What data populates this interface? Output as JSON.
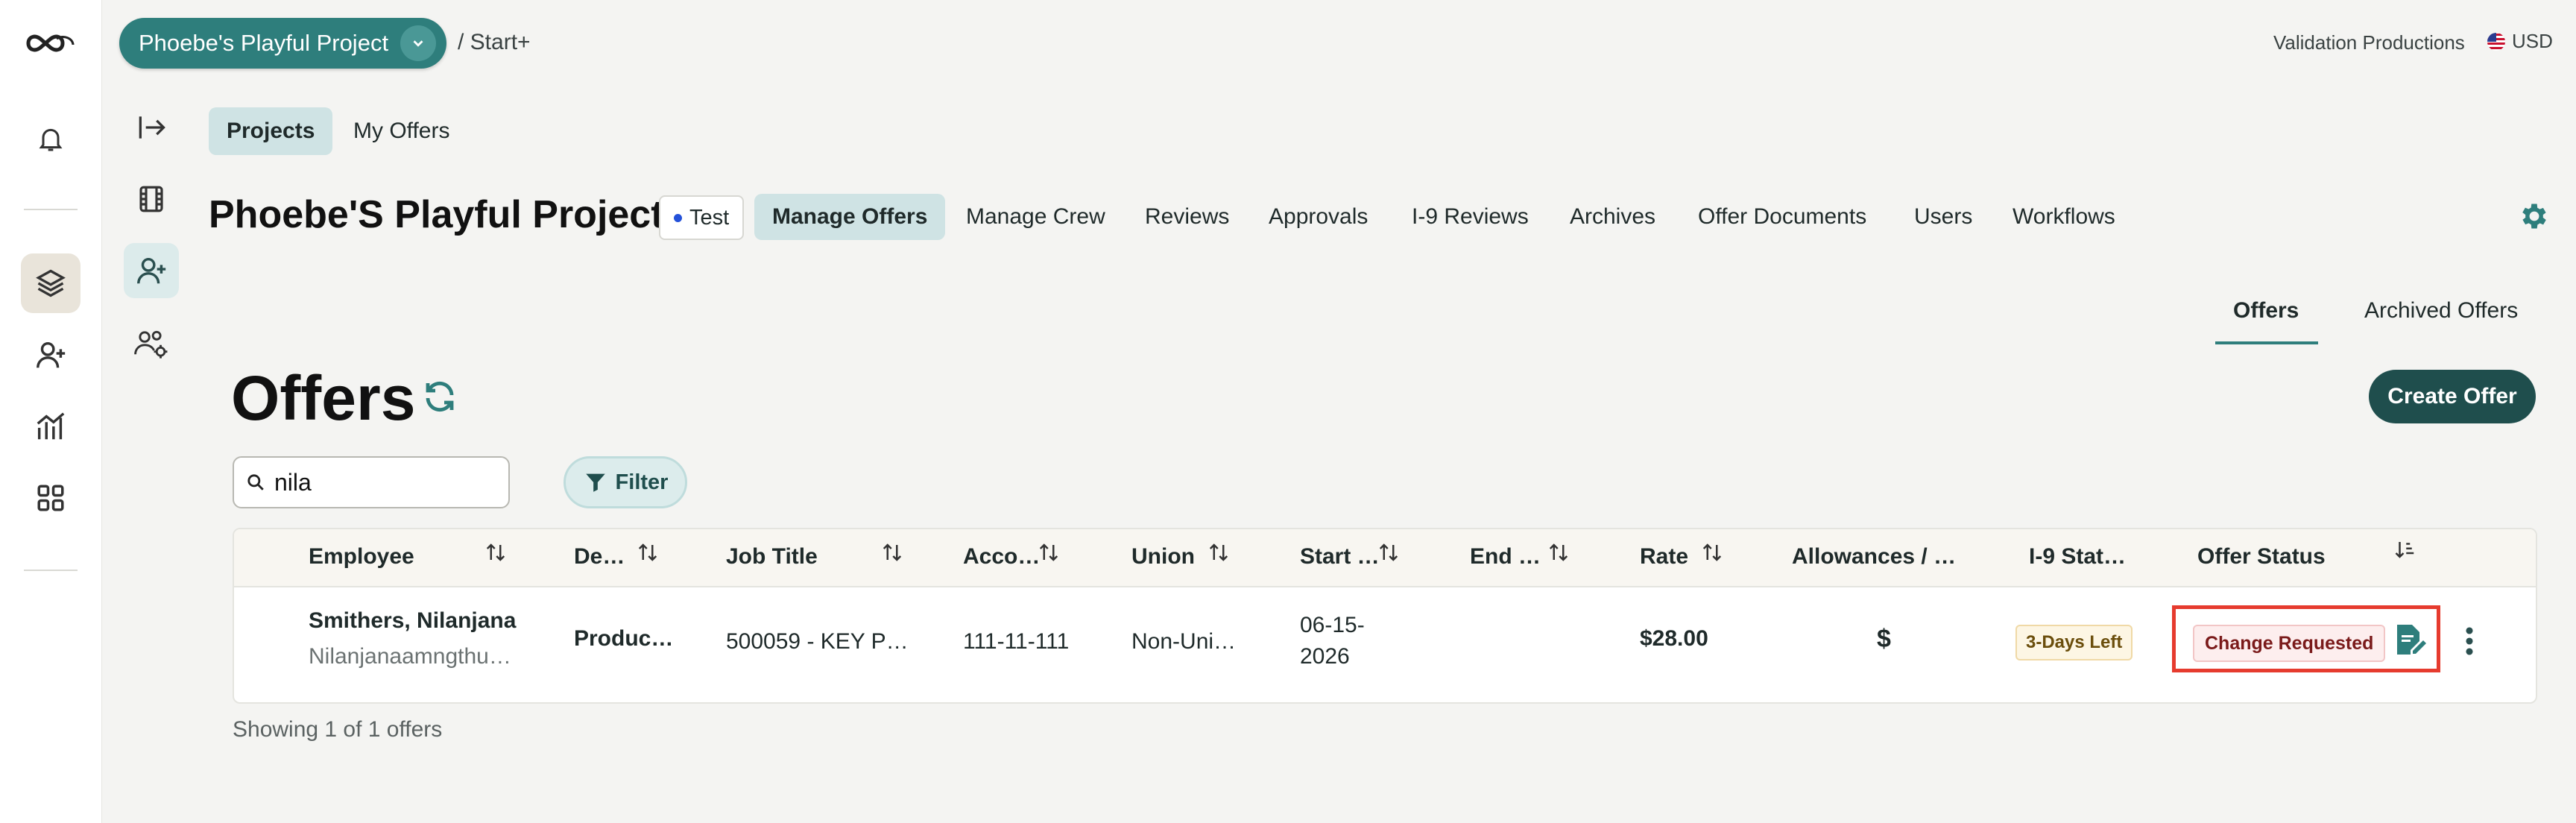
{
  "app": {
    "project_name": "Phoebe's Playful Project",
    "breadcrumb": "/ Start+",
    "company": "Validation Productions",
    "currency": "USD"
  },
  "rail": {
    "icons": [
      "logo-icon",
      "bell-icon",
      "layers-icon",
      "add-user-icon",
      "analytics-icon",
      "grid-icon"
    ]
  },
  "subnav": {
    "icons": [
      "collapse-icon",
      "film-icon",
      "add-user-icon",
      "team-settings-icon"
    ]
  },
  "top_tabs": [
    {
      "label": "Projects",
      "active": true
    },
    {
      "label": "My Offers",
      "active": false
    }
  ],
  "header": {
    "title": "Phoebe'S Playful Project",
    "env_badge": "Test",
    "tabs": [
      {
        "label": "Manage Offers",
        "active": true
      },
      {
        "label": "Manage Crew"
      },
      {
        "label": "Reviews"
      },
      {
        "label": "Approvals"
      },
      {
        "label": "I-9 Reviews"
      },
      {
        "label": "Archives"
      },
      {
        "label": "Offer Documents"
      },
      {
        "label": "Users"
      },
      {
        "label": "Workflows"
      }
    ]
  },
  "offers_tabs": [
    {
      "label": "Offers",
      "active": true
    },
    {
      "label": "Archived Offers",
      "active": false
    }
  ],
  "offers": {
    "heading": "Offers",
    "create_button": "Create Offer",
    "search_value": "nila",
    "filter_label": "Filter",
    "columns": [
      "Employee",
      "De…",
      "Job Title",
      "Acco…",
      "Union",
      "Start …",
      "End …",
      "Rate",
      "Allowances / …",
      "I-9 Stat…",
      "Offer Status"
    ],
    "rows": [
      {
        "employee_name": "Smithers, Nilanjana",
        "employee_email": "Nilanjanaamngthu…",
        "department": "Produc…",
        "job_title": "500059 - KEY P…",
        "account": "111-11-111",
        "union": "Non-Uni…",
        "start_line1": "06-15-",
        "start_line2": "2026",
        "end": "",
        "rate": "$28.00",
        "allowances": "$",
        "i9_status": "3-Days Left",
        "offer_status": "Change Requested"
      }
    ],
    "footer": "Showing 1 of 1 offers"
  },
  "colors": {
    "brand": "#2e7e7c",
    "brand_dark": "#1f4e4d",
    "highlight": "#e63b2e"
  }
}
